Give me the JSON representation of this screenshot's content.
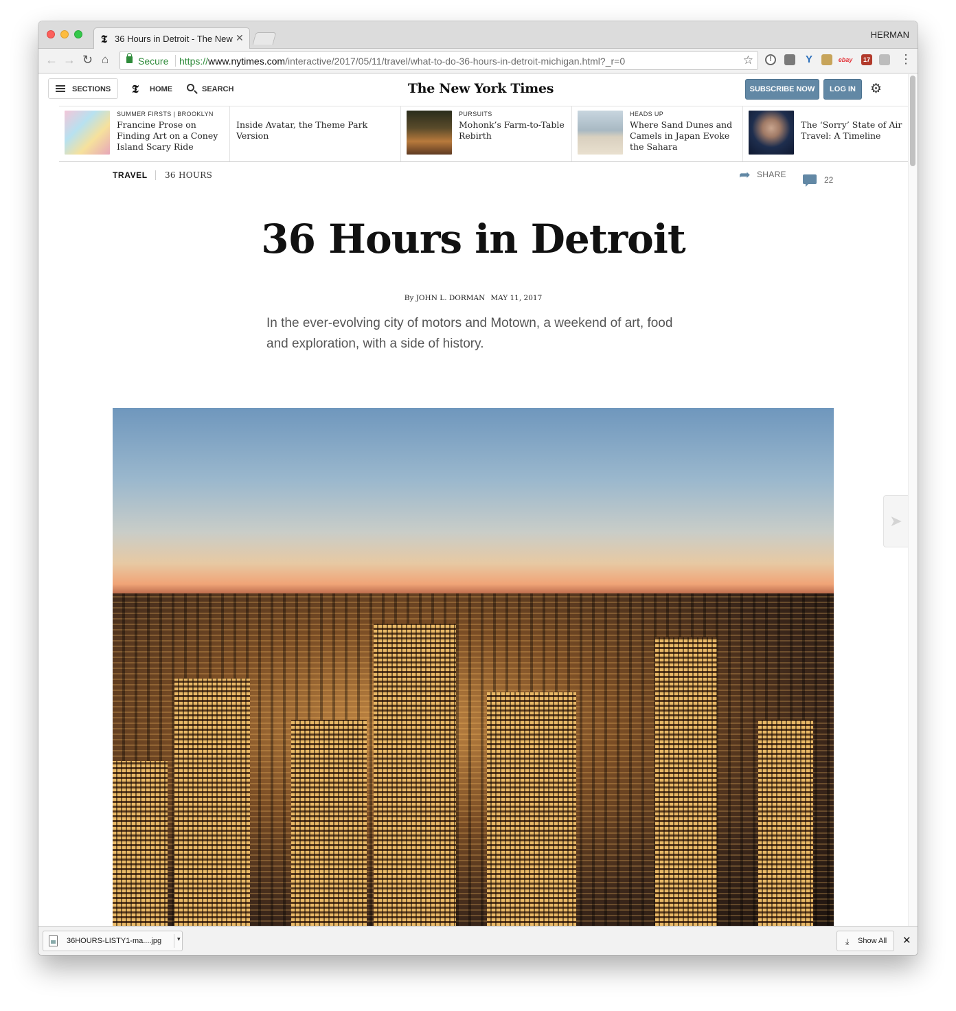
{
  "browser": {
    "tab_title": "36 Hours in Detroit - The New",
    "tab_close": "✕",
    "profile_name": "HERMAN",
    "secure_label": "Secure",
    "url_scheme": "https://",
    "url_host": "www.nytimes.com",
    "url_path": "/interactive/2017/05/11/travel/what-to-do-36-hours-in-detroit-michigan.html?_r=0",
    "ext_calendar_day": "17",
    "ext_ebay": "ebay"
  },
  "nyt_header": {
    "sections_label": "SECTIONS",
    "home_label": "HOME",
    "search_label": "SEARCH",
    "logo_text": "The New York Times",
    "subscribe_label": "SUBSCRIBE NOW",
    "login_label": "LOG IN"
  },
  "ribbon": [
    {
      "kicker": "SUMMER FIRSTS | BROOKLYN",
      "headline": "Francine Prose on Finding Art on a Coney Island Scary Ride",
      "has_thumb": true
    },
    {
      "kicker": "",
      "headline": "Inside Avatar, the Theme Park Version",
      "has_thumb": false
    },
    {
      "kicker": "PURSUITS",
      "headline": "Mohonk’s Farm-to-Table Rebirth",
      "has_thumb": true
    },
    {
      "kicker": "HEADS UP",
      "headline": "Where Sand Dunes and Camels in Japan Evoke the Sahara",
      "has_thumb": true
    },
    {
      "kicker": "",
      "headline": "The ‘Sorry’ State of Air Travel: A Timeline",
      "has_thumb": true
    }
  ],
  "article": {
    "section": "TRAVEL",
    "series": "36 HOURS",
    "share_label": "SHARE",
    "comment_count": "22",
    "headline": "36 Hours in Detroit",
    "byline": "By JOHN L. DORMAN",
    "date": "MAY 11, 2017",
    "summary": "In the ever-evolving city of motors and Motown, a weekend of art, food and exploration, with a side of history."
  },
  "downloads": {
    "file_name": "36HOURS-LISTY1-ma....jpg",
    "show_all_label": "Show All",
    "close_label": "✕"
  },
  "colors": {
    "nyt_button_blue": "#6288a5",
    "secure_green": "#2e8b3a"
  }
}
